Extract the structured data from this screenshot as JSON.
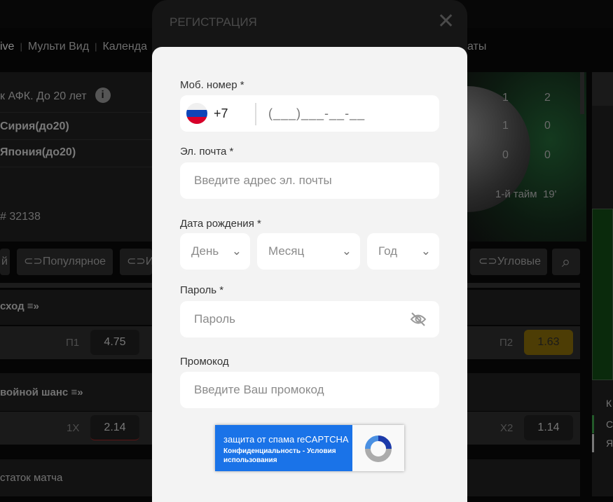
{
  "nav": {
    "items": [
      "ive",
      "Мульти Вид",
      "Календа",
      "аты"
    ]
  },
  "match": {
    "league": "к АФК. До 20 лет",
    "team1": "Сирия(до20)",
    "team2": "Япония(до20)",
    "match_id": "# 32138",
    "score_header": [
      "1",
      "2"
    ],
    "score_team1": [
      "1",
      "0"
    ],
    "score_team2": [
      "0",
      "0"
    ],
    "period": "1-й тайм",
    "minute": "19'"
  },
  "tabs": [
    "й",
    "Популярное",
    "И",
    "Угловые"
  ],
  "markets": [
    {
      "title": "сход",
      "left_label": "П1",
      "left_odd": "4.75",
      "right_label": "П2",
      "right_odd": "1.63"
    },
    {
      "title": "войной шанс",
      "left_label": "1Х",
      "left_odd": "2.14",
      "right_label": "Х2",
      "right_odd": "1.14"
    },
    {
      "title": "статок матча"
    }
  ],
  "side": {
    "rows": [
      "К",
      "С",
      "Я"
    ]
  },
  "modal": {
    "title": "РЕГИСТРАЦИЯ",
    "phone": {
      "label": "Моб. номер *",
      "country_code": "+7",
      "placeholder": "(___)___-__-__",
      "flag": "russia-flag"
    },
    "email": {
      "label": "Эл. почта *",
      "placeholder": "Введите адрес эл. почты"
    },
    "birthdate": {
      "label": "Дата рождения *",
      "day": "День",
      "month": "Месяц",
      "year": "Год"
    },
    "password": {
      "label": "Пароль *",
      "placeholder": "Пароль"
    },
    "promo": {
      "label": "Промокод",
      "placeholder": "Введите Ваш промокод"
    },
    "recaptcha": {
      "title": "защита от спама reCAPTCHA",
      "links": "Конфиденциальность - Условия использования"
    }
  },
  "colors": {
    "accent_odd": "#4d3d05",
    "recaptcha_blue": "#1a73e8",
    "modal_bg": "#f3f3f3"
  }
}
